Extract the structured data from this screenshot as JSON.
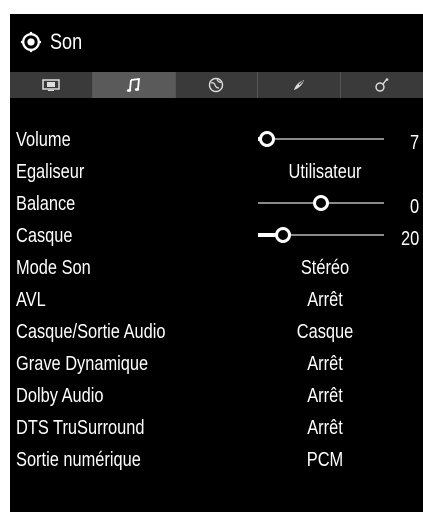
{
  "header": {
    "title": "Son",
    "icon": "gear-icon"
  },
  "tabs": [
    {
      "icon": "picture-icon",
      "active": false
    },
    {
      "icon": "music-note-icon",
      "active": true
    },
    {
      "icon": "globe-icon",
      "active": false
    },
    {
      "icon": "satellite-icon",
      "active": false
    },
    {
      "icon": "settings-icon",
      "active": false
    }
  ],
  "settings": {
    "volume": {
      "label": "Volume",
      "value": "7",
      "level": 0.07
    },
    "egaliseur": {
      "label": "Egaliseur",
      "value": "Utilisateur"
    },
    "balance": {
      "label": "Balance",
      "value": "0",
      "level": 0.5
    },
    "casque": {
      "label": "Casque",
      "value": "20",
      "level": 0.2
    },
    "mode_son": {
      "label": "Mode Son",
      "value": "Stéréo"
    },
    "avl": {
      "label": "AVL",
      "value": "Arrêt"
    },
    "casque_sortie": {
      "label": "Casque/Sortie Audio",
      "value": "Casque"
    },
    "grave_dynamique": {
      "label": "Grave Dynamique",
      "value": "Arrêt"
    },
    "dolby_audio": {
      "label": "Dolby Audio",
      "value": "Arrêt"
    },
    "dts_trusurround": {
      "label": "DTS TruSurround",
      "value": "Arrêt"
    },
    "sortie_numerique": {
      "label": "Sortie numérique",
      "value": "PCM"
    }
  },
  "colors": {
    "background": "#000000",
    "tab_bar": "#3a3a3a",
    "tab_active": "#5a5a5a",
    "text": "#ffffff",
    "slider_track": "#8a8a8a"
  }
}
